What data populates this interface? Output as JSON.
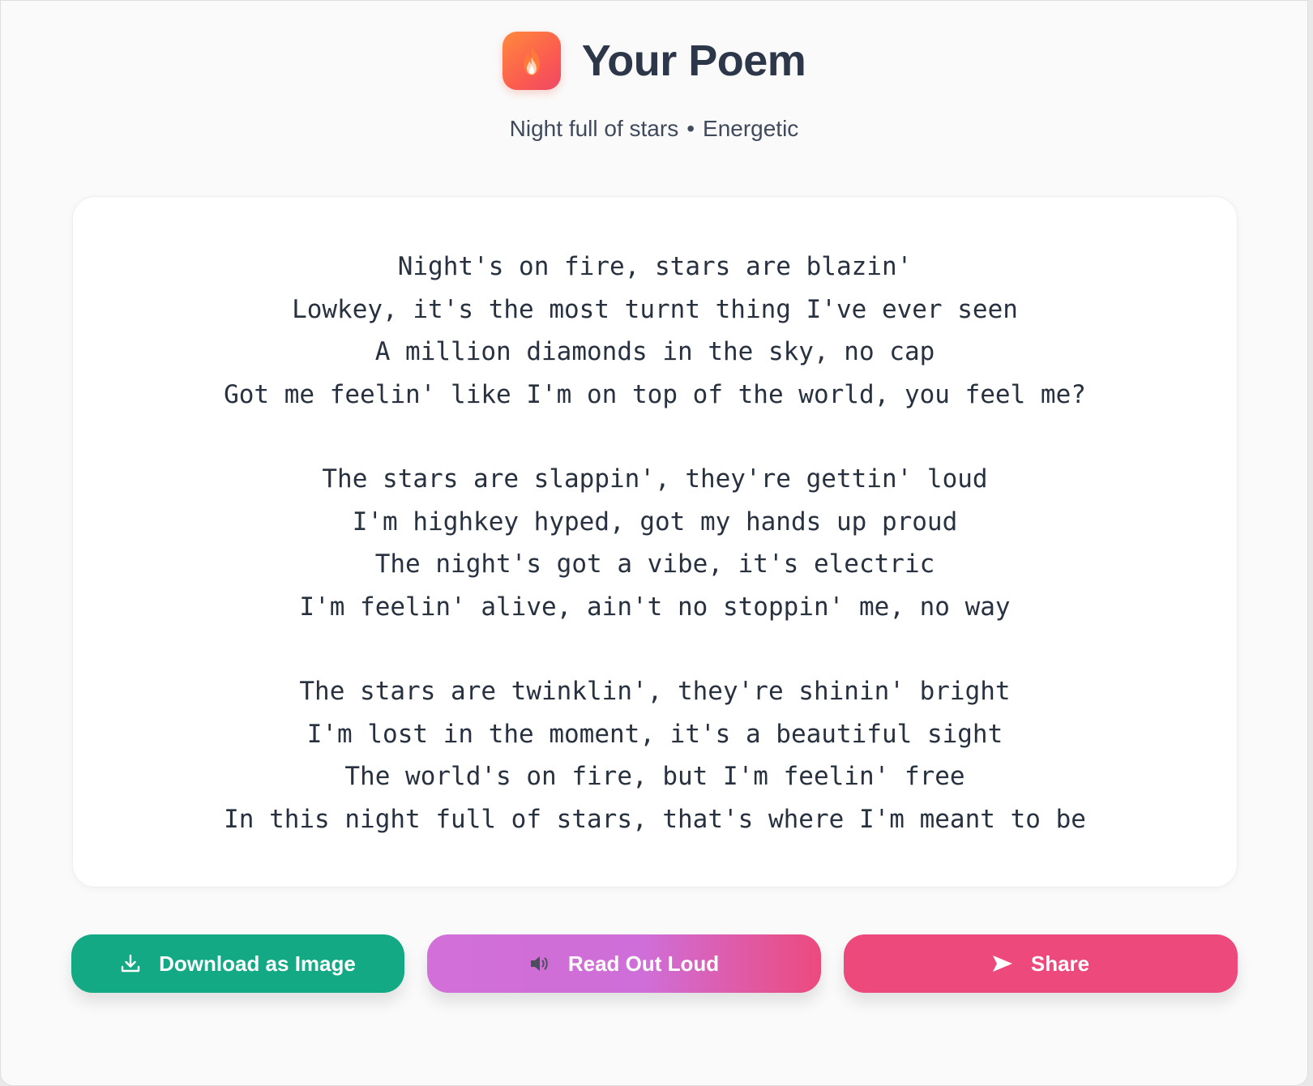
{
  "header": {
    "title": "Your Poem",
    "logo_icon": "fire-icon",
    "subtitle_topic": "Night full of stars",
    "subtitle_separator": "•",
    "subtitle_mood": "Energetic"
  },
  "poem": {
    "stanzas": [
      [
        "Night's on fire, stars are blazin'",
        "Lowkey, it's the most turnt thing I've ever seen",
        "A million diamonds in the sky, no cap",
        "Got me feelin' like I'm on top of the world, you feel me?"
      ],
      [
        "The stars are slappin', they're gettin' loud",
        "I'm highkey hyped, got my hands up proud",
        "The night's got a vibe, it's electric",
        "I'm feelin' alive, ain't no stoppin' me, no way"
      ],
      [
        "The stars are twinklin', they're shinin' bright",
        "I'm lost in the moment, it's a beautiful sight",
        "The world's on fire, but I'm feelin' free",
        "In this night full of stars, that's where I'm meant to be"
      ]
    ]
  },
  "actions": {
    "download": {
      "label": "Download as Image",
      "icon": "download-icon",
      "color": "#13a985"
    },
    "read": {
      "label": "Read Out Loud",
      "icon": "speaker-icon",
      "color": "#d26fd9"
    },
    "share": {
      "label": "Share",
      "icon": "send-icon",
      "color": "#ee497d"
    }
  }
}
